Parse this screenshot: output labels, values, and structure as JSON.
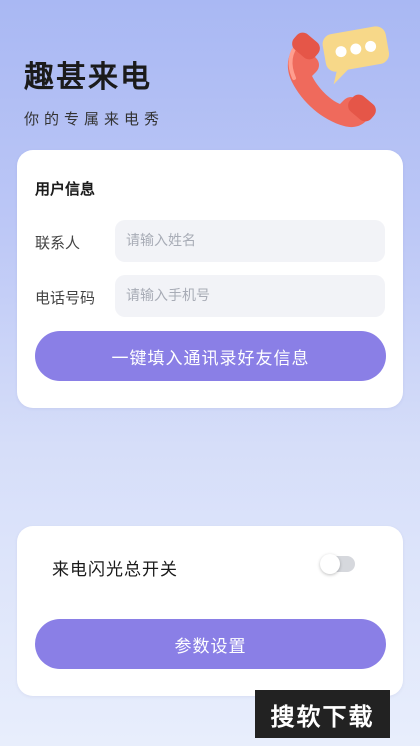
{
  "header": {
    "title": "趣甚来电",
    "subtitle": "你的专属来电秀"
  },
  "hero": {
    "icon": "phone-chat-bubble-icon"
  },
  "user_info": {
    "title": "用户信息",
    "contact_label": "联系人",
    "contact_placeholder": "请输入姓名",
    "phone_label": "电话号码",
    "phone_placeholder": "请输入手机号",
    "fill_button": "一键填入通讯录好友信息"
  },
  "flash": {
    "label": "来电闪光总开关",
    "enabled": false,
    "settings_button": "参数设置"
  },
  "watermark": {
    "text": "搜软下载"
  },
  "colors": {
    "accent": "#8a7fe6",
    "background_top": "#a9b8f3",
    "background_bottom": "#e8eefc"
  }
}
